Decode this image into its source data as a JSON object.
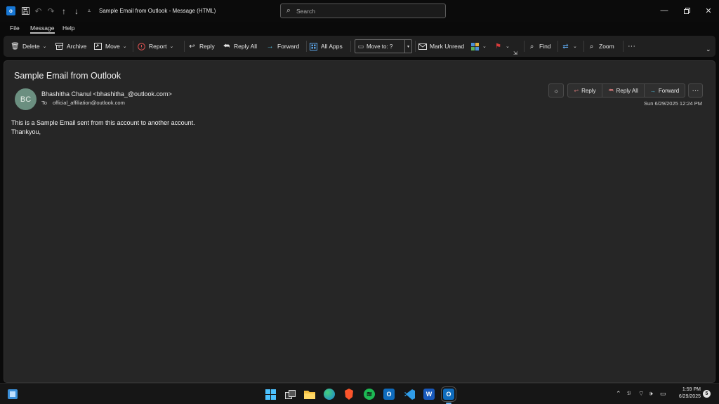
{
  "window": {
    "title": "Sample Email from Outlook  -  Message (HTML)",
    "search_placeholder": "Search"
  },
  "menu": [
    "File",
    "Message",
    "Help"
  ],
  "ribbon": {
    "delete": "Delete",
    "archive": "Archive",
    "move": "Move",
    "report": "Report",
    "reply": "Reply",
    "reply_all": "Reply All",
    "forward": "Forward",
    "all_apps": "All Apps",
    "move_to": "Move to: ?",
    "mark_unread": "Mark Unread",
    "find": "Find",
    "zoom": "Zoom"
  },
  "message": {
    "subject": "Sample Email from Outlook",
    "avatar_initials": "BC",
    "sender": "Bhashitha Chanul <bhashitha_@outlook.com>",
    "to_label": "To",
    "to_address": "official_affiliation@outlook.com",
    "date": "Sun 6/29/2025 12:24 PM",
    "body_lines": [
      "This is a Sample Email sent from this account to another account.",
      "Thankyou,"
    ],
    "actions": {
      "reply": "Reply",
      "reply_all": "Reply All",
      "forward": "Forward"
    }
  },
  "taskbar": {
    "time": "1:59 PM",
    "date": "6/29/2025",
    "notification_count": "5",
    "apps": [
      "windows-start",
      "task-view",
      "file-explorer",
      "edge",
      "brave",
      "spotify",
      "outlook-new",
      "vscode",
      "word",
      "outlook"
    ]
  },
  "colors": {
    "window_bg": "#0a0a0a",
    "ribbon_bg": "#202020",
    "pane_bg": "#262626",
    "avatar": "#6b8f80",
    "outlook_blue": "#1777d4",
    "flag_red": "#d83b3b"
  }
}
